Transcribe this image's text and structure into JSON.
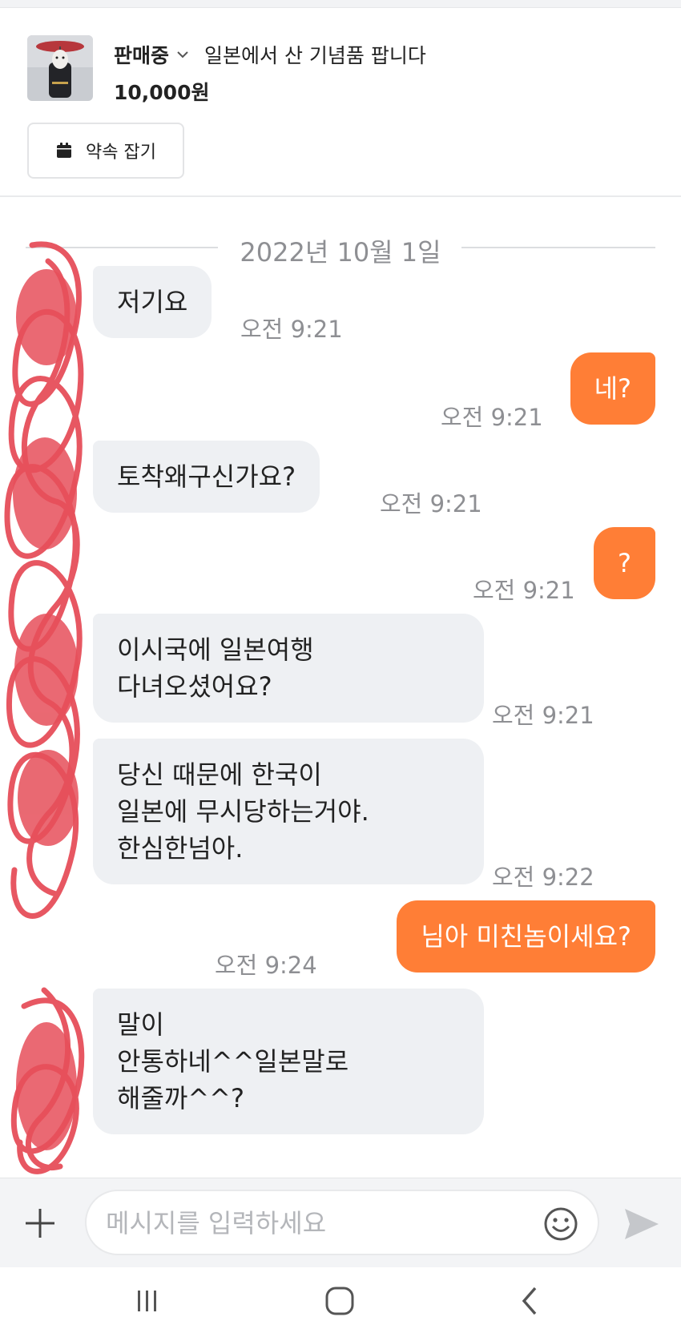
{
  "product": {
    "status": "판매중",
    "title": "일본에서 산 기념품 팝니다",
    "price": "10,000원",
    "appointment_button": "약속 잡기"
  },
  "chat": {
    "date_divider": "2022년 10월 1일",
    "messages": [
      {
        "side": "received",
        "text": "저기요",
        "time": "오전 9:21"
      },
      {
        "side": "sent",
        "text": "네?",
        "time": "오전 9:21"
      },
      {
        "side": "received",
        "text": "토착왜구신가요?",
        "time": "오전 9:21"
      },
      {
        "side": "sent",
        "text": "?",
        "time": "오전 9:21"
      },
      {
        "side": "received",
        "text": "이시국에 일본여행\n다녀오셨어요?",
        "time": "오전 9:21"
      },
      {
        "side": "received",
        "text": "당신 때문에 한국이\n일본에 무시당하는거야.\n한심한넘아.",
        "time": "오전 9:22"
      },
      {
        "side": "sent",
        "text": "님아 미친놈이세요?",
        "time": "오전 9:24"
      },
      {
        "side": "received",
        "text": "말이\n안통하네^^일본말로\n해줄까^^?",
        "time": ""
      }
    ]
  },
  "input": {
    "placeholder": "메시지를 입력하세요"
  },
  "colors": {
    "accent": "#ff7e36",
    "received_bubble": "#eef0f3",
    "redaction": "#e64f5a"
  },
  "icons": [
    "calendar-icon",
    "chevron-down-icon",
    "plus-icon",
    "emoji-icon",
    "send-icon",
    "recent-apps-icon",
    "home-icon",
    "back-icon"
  ]
}
